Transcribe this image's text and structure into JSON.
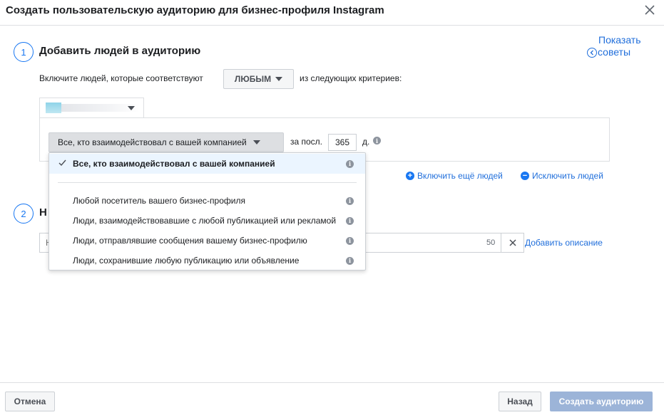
{
  "dialog": {
    "title": "Создать пользовательскую аудиторию для бизнес-профиля Instagram"
  },
  "tips": {
    "line1": "Показать",
    "line2": "советы"
  },
  "step1": {
    "number": "1",
    "title": "Добавить людей в аудиторию",
    "include_prefix": "Включите людей, которые соответствуют",
    "match_value": "ЛЮБЫМ",
    "include_suffix": "из следующих критериев:",
    "event_value": "Все, кто взаимодействовал с вашей компанией",
    "period_label": "за посл.",
    "days": "365",
    "days_unit": "д.",
    "include_more": "Включить ещё людей",
    "exclude": "Исключить людей"
  },
  "dropdown": {
    "items": [
      "Все, кто взаимодействовал с вашей компанией",
      "Любой посетитель вашего бизнес-профиля",
      "Люди, взаимодействовавшие с любой публикацией или рекламой",
      "Люди, отправлявшие сообщения вашему бизнес-профилю",
      "Люди, сохранившие любую публикацию или объявление"
    ],
    "selected_index": 0
  },
  "step2": {
    "number": "2",
    "title_visible": "Н",
    "name_placeholder": "Н",
    "char_counter": "50",
    "add_description": "Добавить описание"
  },
  "footer": {
    "cancel": "Отмена",
    "back": "Назад",
    "create": "Создать аудиторию"
  },
  "colors": {
    "accent": "#1877f2",
    "link": "#216fdb",
    "primary_disabled": "#9cb4d8",
    "selected_bg": "#ebf5ff"
  }
}
